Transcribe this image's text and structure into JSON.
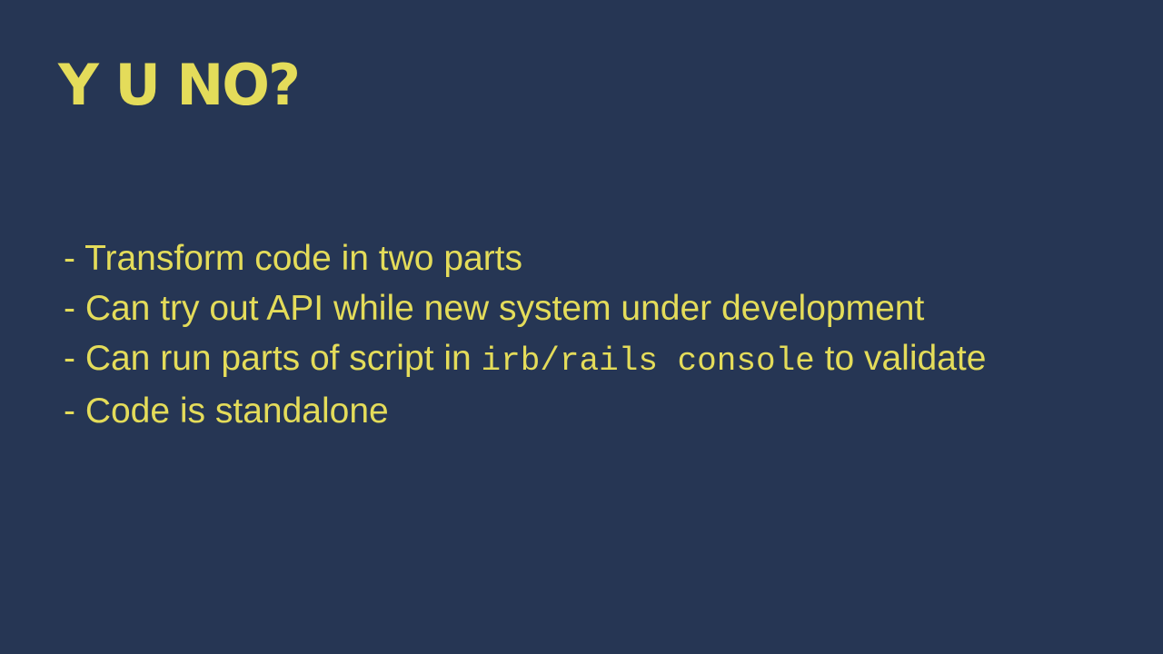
{
  "slide": {
    "title": "Y U NO?",
    "bullets": [
      {
        "text": "- Transform code in two parts"
      },
      {
        "text": "- Can try out API while new system under development"
      },
      {
        "text_before": "- Can run parts of script in ",
        "code": "irb/rails console",
        "text_after": " to validate"
      },
      {
        "text": "- Code is standalone"
      }
    ]
  },
  "colors": {
    "background": "#263654",
    "text": "#e4dc5a"
  }
}
